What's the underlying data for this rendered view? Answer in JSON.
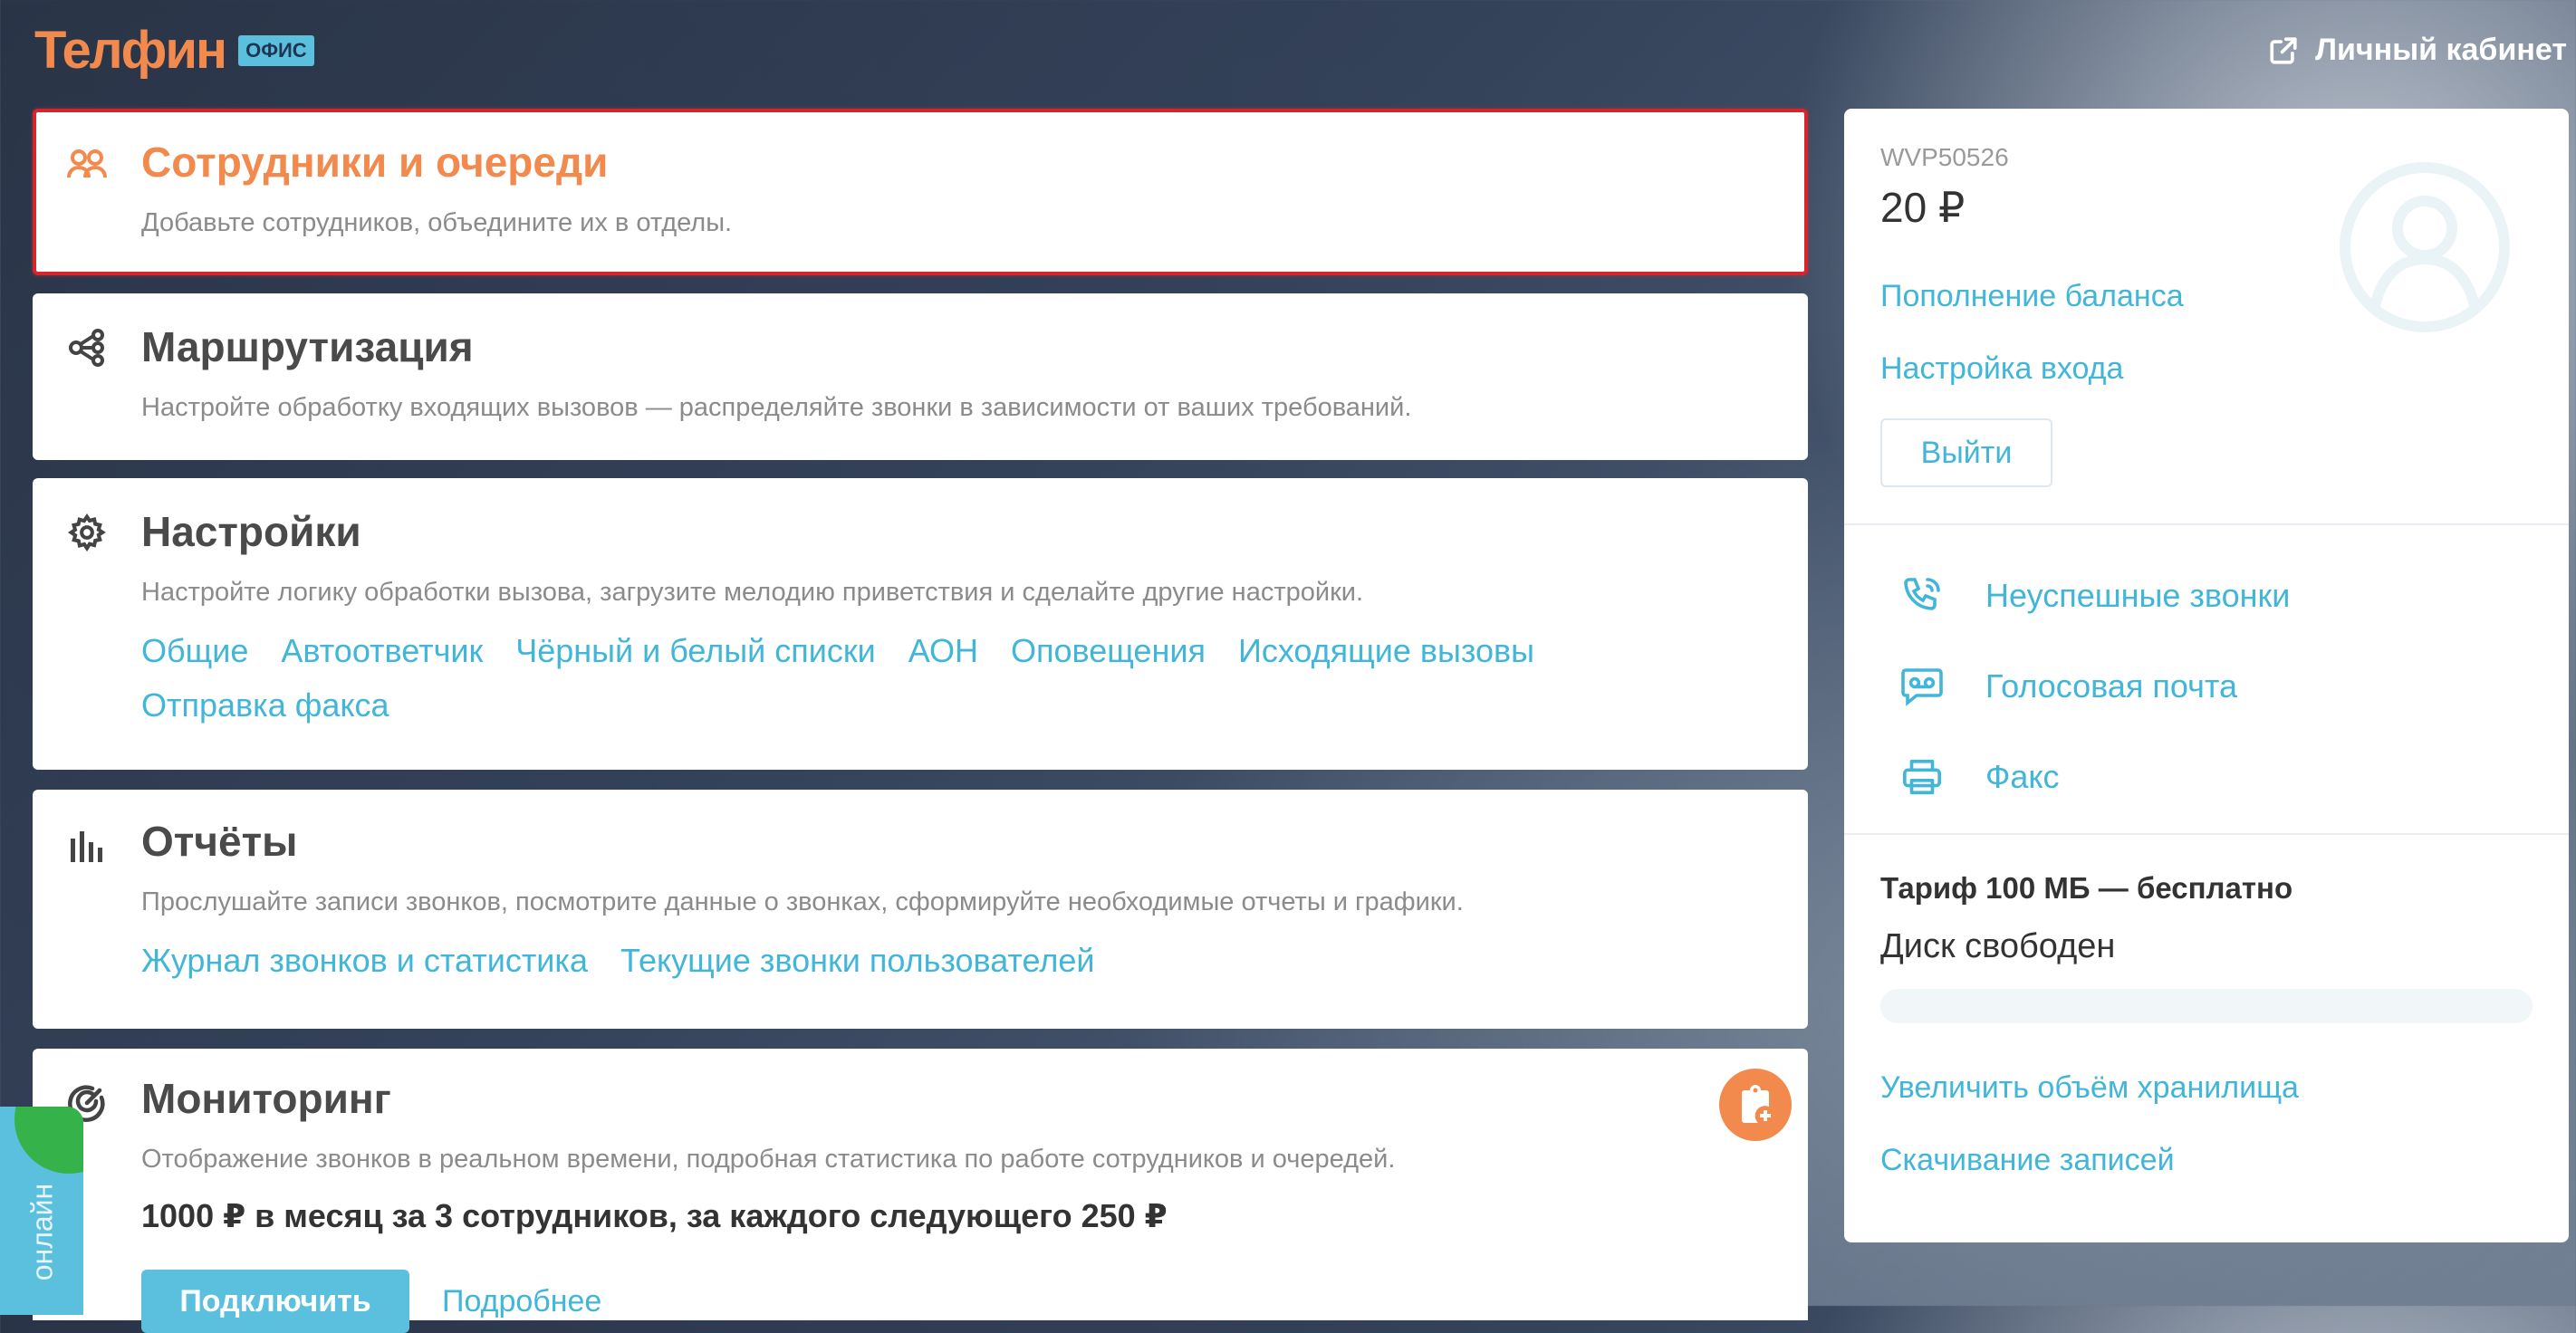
{
  "header": {
    "logo": "Телфин",
    "logo_badge": "ОФИС",
    "cabinet_label": "Личный кабинет"
  },
  "cards": {
    "staff": {
      "title": "Сотрудники и очереди",
      "description": "Добавьте сотрудников, объедините их в отделы."
    },
    "routing": {
      "title": "Маршрутизация",
      "description": "Настройте обработку входящих вызовов — распределяйте звонки в зависимости от ваших требований."
    },
    "settings": {
      "title": "Настройки",
      "description": "Настройте логику обработки вызова, загрузите мелодию приветствия и сделайте другие настройки.",
      "links": [
        "Общие",
        "Автоответчик",
        "Чёрный и белый списки",
        "АОН",
        "Оповещения",
        "Исходящие вызовы",
        "Отправка факса"
      ]
    },
    "reports": {
      "title": "Отчёты",
      "description": "Прослушайте записи звонков, посмотрите данные о звонках, сформируйте необходимые отчеты и графики.",
      "links": [
        "Журнал звонков и статистика",
        "Текущие звонки пользователей"
      ]
    },
    "monitoring": {
      "title": "Мониторинг",
      "description": "Отображение звонков в реальном времени, подробная статистика по работе сотрудников и очередей.",
      "price": "1000 ₽ в месяц за 3 сотрудников, за каждого следующего 250 ₽",
      "connect_label": "Подключить",
      "more_label": "Подробнее"
    }
  },
  "sidebar": {
    "account_id": "WVP50526",
    "balance": "20 ₽",
    "topup_label": "Пополнение баланса",
    "login_settings_label": "Настройка входа",
    "logout_label": "Выйти",
    "missed_calls_label": "Неуспешные звонки",
    "voicemail_label": "Голосовая почта",
    "fax_label": "Факс",
    "tariff": "Тариф 100 МБ — бесплатно",
    "disk_status": "Диск свободен",
    "disk_used_fraction": 0,
    "increase_storage_label": "Увеличить объём хранилища",
    "download_records_label": "Скачивание записей"
  },
  "online_tab": "онлайн",
  "colors": {
    "accent_orange": "#f28a4d",
    "link_blue": "#41b6d9",
    "active_border": "#d6262b"
  }
}
